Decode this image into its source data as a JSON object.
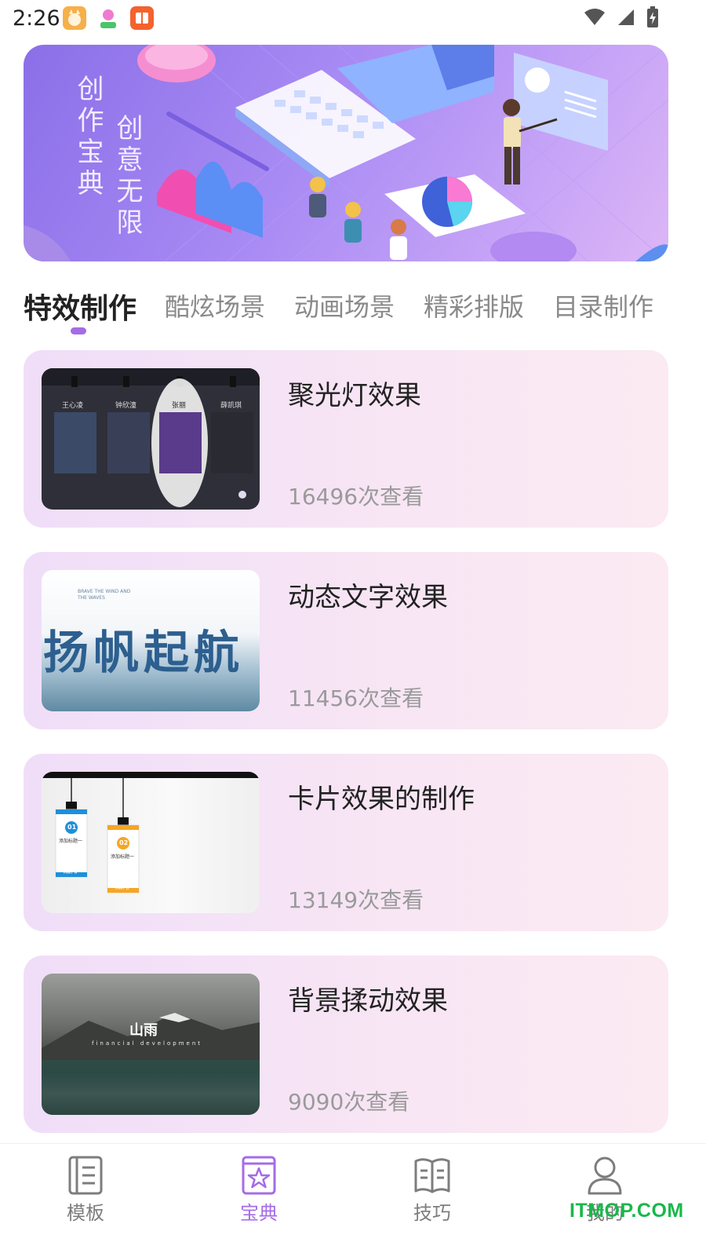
{
  "status_bar": {
    "time": "2:26",
    "icons": [
      "cat-app-icon",
      "avatar-app-icon",
      "book-app-icon",
      "wifi-icon",
      "signal-icon",
      "battery-icon"
    ]
  },
  "banner": {
    "title_line1": "创作宝典",
    "title_line2": "创意无限"
  },
  "tabs": [
    {
      "label": "特效制作",
      "active": true
    },
    {
      "label": "酷炫场景",
      "active": false
    },
    {
      "label": "动画场景",
      "active": false
    },
    {
      "label": "精彩排版",
      "active": false
    },
    {
      "label": "目录制作",
      "active": false
    }
  ],
  "cards": [
    {
      "title": "聚光灯效果",
      "views": "16496次查看",
      "thumb_names": [
        "王心凌",
        "钟欣潼",
        "张丽",
        "薛凯琪"
      ]
    },
    {
      "title": "动态文字效果",
      "views": "11456次查看",
      "thumb_small": "BRAVE THE WIND AND THE WAVES",
      "thumb_big": "扬帆起航"
    },
    {
      "title": "卡片效果的制作",
      "views": "13149次查看",
      "thumb_badges": [
        "01",
        "02"
      ],
      "thumb_texts": [
        "添加标题一",
        "添加标题一"
      ],
      "thumb_parts": [
        "PART A",
        "PART B"
      ]
    },
    {
      "title": "背景揉动效果",
      "views": "9090次查看",
      "thumb_title": "山雨",
      "thumb_sub": "financial development"
    }
  ],
  "bottom_nav": [
    {
      "label": "模板",
      "icon": "template-icon",
      "active": false
    },
    {
      "label": "宝典",
      "icon": "guide-star-icon",
      "active": true
    },
    {
      "label": "技巧",
      "icon": "book-icon",
      "active": false
    },
    {
      "label": "我的",
      "icon": "profile-icon",
      "active": false
    }
  ],
  "watermark": "ITMOP.COM",
  "colors": {
    "accent": "#a56ce6",
    "card_bg_start": "#f0def9",
    "card_bg_end": "#fbeaf1",
    "banner": "#9b7cf0",
    "watermark": "#19b84a"
  }
}
